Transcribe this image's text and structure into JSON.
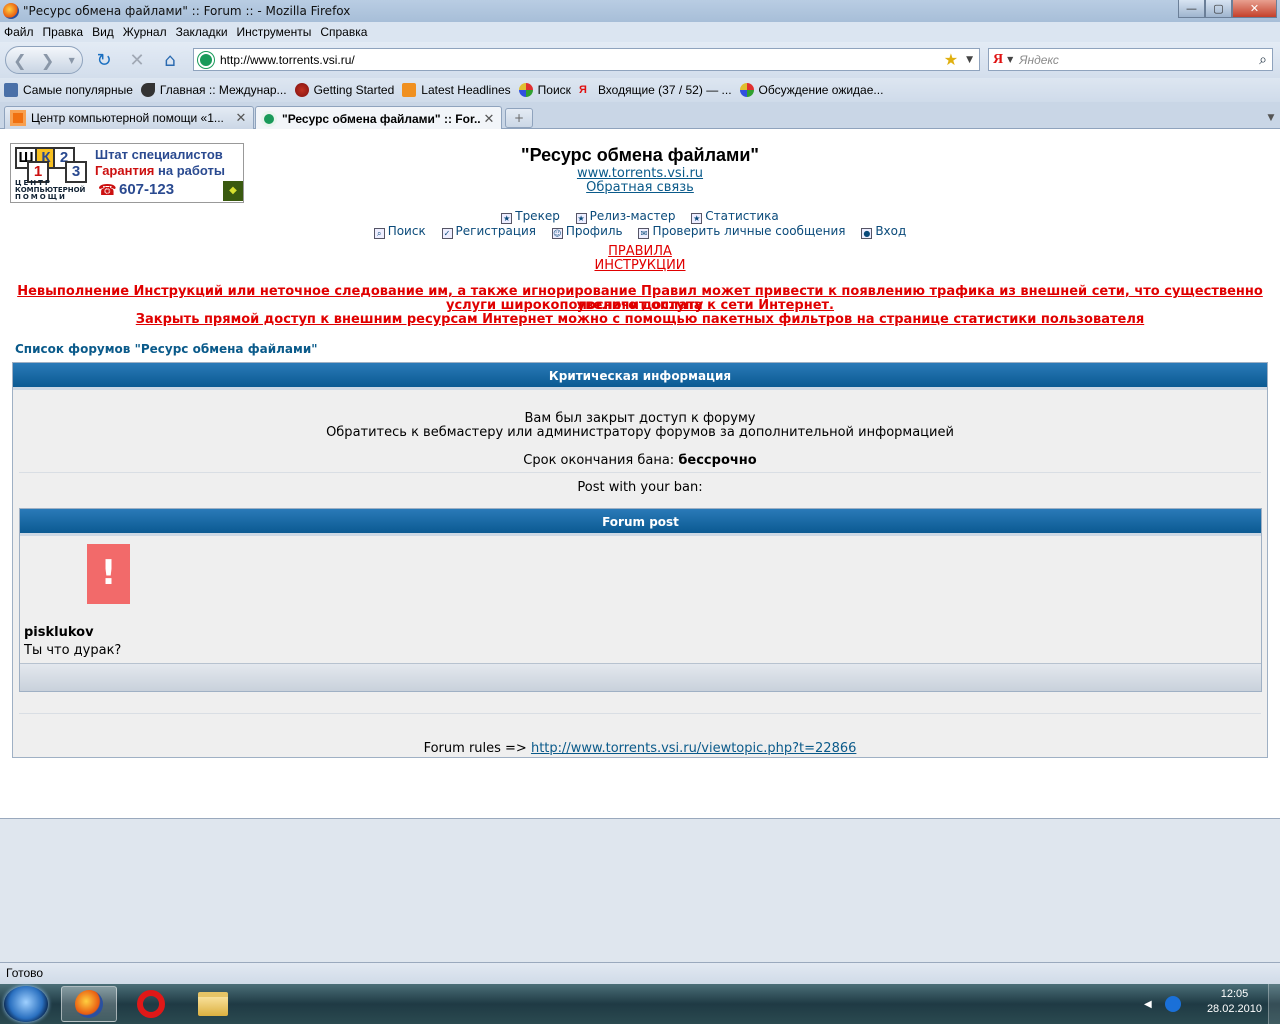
{
  "window": {
    "title": "\"Ресурс обмена файлами\" :: Forum :: - Mozilla Firefox",
    "btn_min": "—",
    "btn_max": "▢",
    "btn_close": "✕"
  },
  "menu": [
    "Файл",
    "Правка",
    "Вид",
    "Журнал",
    "Закладки",
    "Инструменты",
    "Справка"
  ],
  "nav": {
    "url": "http://www.torrents.vsi.ru/",
    "search_placeholder": "Яндекс",
    "search_engine_letter": "Я"
  },
  "bookmarks": [
    {
      "label": "Самые популярные",
      "icon": "folder-icon"
    },
    {
      "label": "Главная :: Междунар...",
      "icon": "bird-icon"
    },
    {
      "label": "Getting Started",
      "icon": "firefox-icon"
    },
    {
      "label": "Latest Headlines",
      "icon": "rss-icon"
    },
    {
      "label": "Поиск",
      "icon": "search-bookmark-icon"
    },
    {
      "label": "Входящие (37 / 52) — ...",
      "icon": "yandex-mail-icon"
    },
    {
      "label": "Обсуждение ожидае...",
      "icon": "forum-icon"
    }
  ],
  "tabs": [
    {
      "label": "Центр компьютерной помощи «1...",
      "active": false
    },
    {
      "label": "\"Ресурс обмена файлами\" :: For...",
      "active": true
    }
  ],
  "page": {
    "banner": {
      "blocks": [
        "Ш",
        "К",
        "1",
        "2",
        "3"
      ],
      "center_text": "ЦЕНТР",
      "center_sub1": "КОМПЬЮТЕРНОЙ",
      "center_sub2": "ПОМОЩИ",
      "line1": "Штат специалистов",
      "line2a": "Гарантия",
      "line2b": "на работы",
      "phone": "607-123"
    },
    "title": "\"Ресурс обмена файлами\"",
    "site_link": "www.torrents.vsi.ru",
    "feedback_link": "Обратная связь",
    "nav_row1": [
      "Трекер",
      "Релиз-мастер",
      "Статистика"
    ],
    "nav_row2": [
      "Поиск",
      "Регистрация",
      "Профиль",
      "Проверить личные сообщения",
      "Вход"
    ],
    "rules_link": "ПРАВИЛА",
    "instructions_link": "ИНСТРУКЦИИ",
    "warning_line1": "Невыполнение Инструкций или неточное следование им, а также игнорирование Правил может привести к появлению трафика из внешней сети, что существенно увеличит оплату",
    "warning_line2": "услуги широкополосного доступа к сети Интернет.",
    "warning_line3": "Закрыть прямой доступ к внешним ресурсам Интернет можно с помощью пакетных фильтров на странице статистики пользователя",
    "forum_list_link": "Список форумов \"Ресурс обмена файлами\"",
    "panel": {
      "header": "Критическая информация",
      "msg1": "Вам был закрыт доступ к форуму",
      "msg2": "Обратитесь к вебмастеру или администратору форумов за дополнительной информацией",
      "ban_label": "Срок окончания бана:",
      "ban_value": "бессрочно",
      "post_with_ban": "Post with your ban:",
      "post_header": "Forum post",
      "avatar_glyph": "!",
      "post_author": "pisklukov",
      "post_message": "Ты что дурак?",
      "rules_prefix": "Forum rules =>",
      "rules_url": "http://www.torrents.vsi.ru/viewtopic.php?t=22866"
    }
  },
  "status": "Готово",
  "taskbar": {
    "time": "12:05",
    "date": "28.02.2010",
    "tray_arrow": "◀"
  },
  "colors": {
    "panel_header": "#0b5a92",
    "link": "#0a5a8a",
    "warning": "#e00000",
    "avatar": "#f26a6a"
  }
}
